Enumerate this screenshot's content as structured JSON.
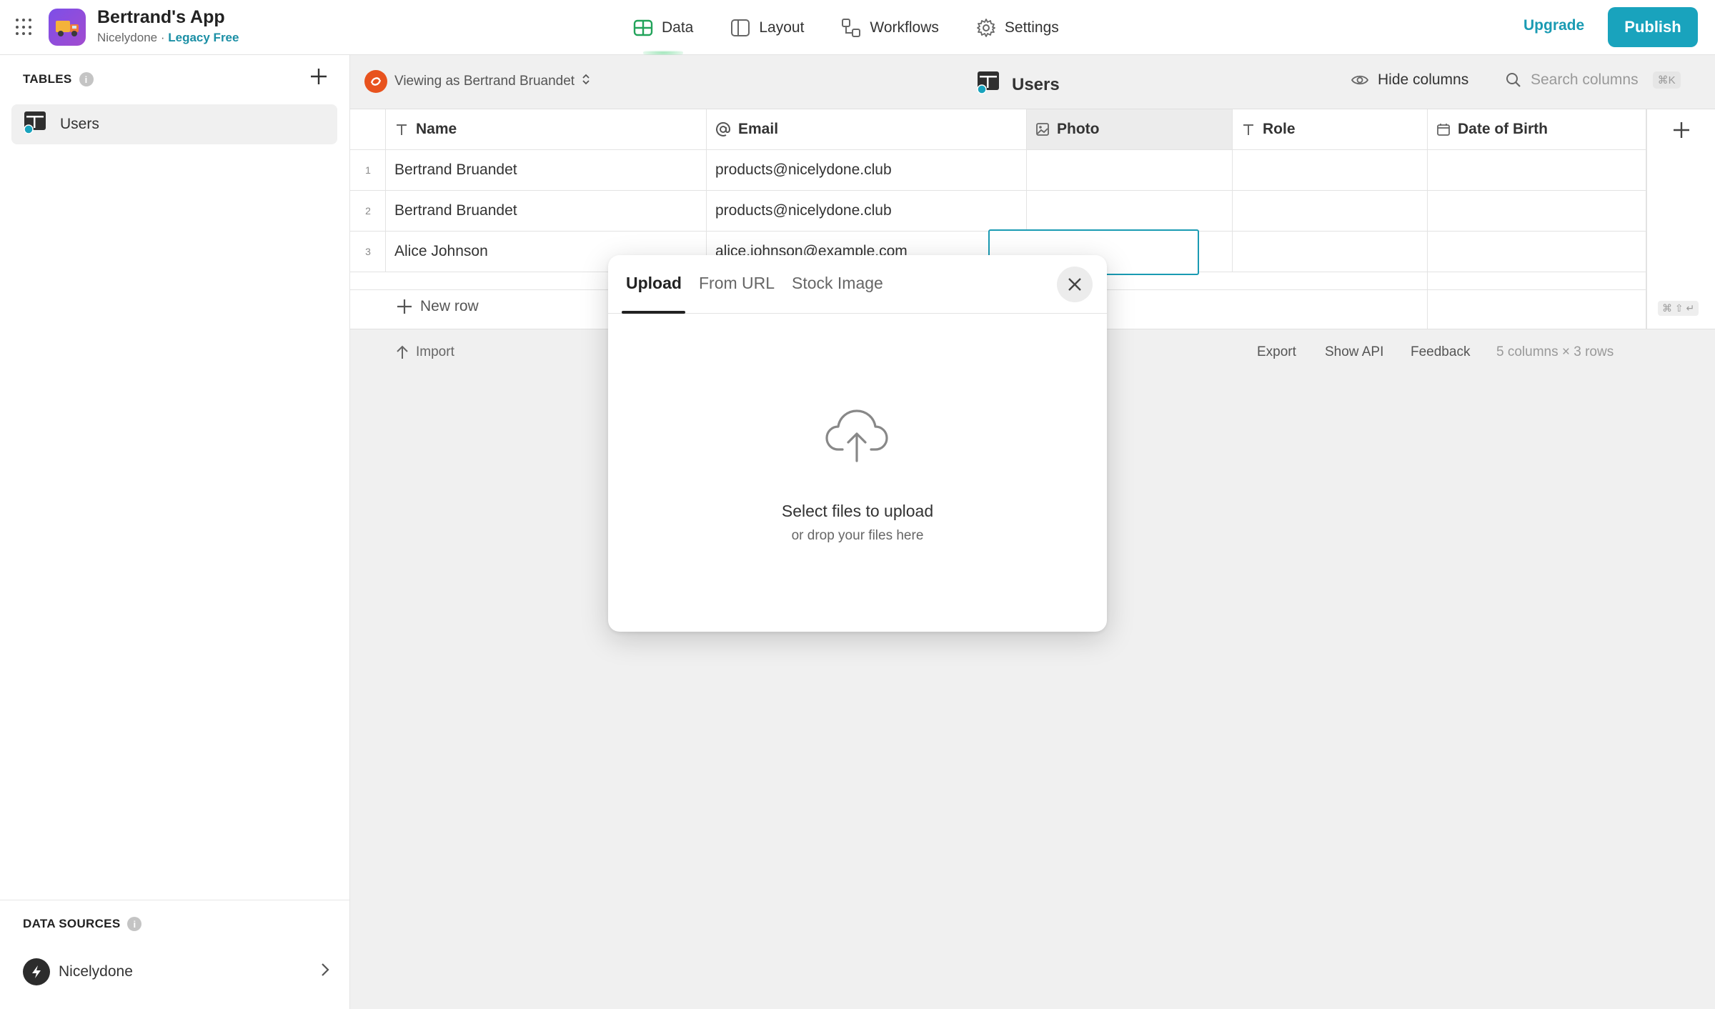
{
  "app": {
    "title": "Bertrand's App",
    "org": "Nicelydone",
    "separator": "·",
    "plan": "Legacy Free"
  },
  "nav": {
    "data": "Data",
    "layout": "Layout",
    "workflows": "Workflows",
    "settings": "Settings"
  },
  "actions": {
    "upgrade": "Upgrade",
    "publish": "Publish"
  },
  "sidebar": {
    "tables_heading": "TABLES",
    "tables": [
      {
        "label": "Users"
      }
    ],
    "data_sources_heading": "DATA SOURCES",
    "data_sources": [
      {
        "label": "Nicelydone"
      }
    ]
  },
  "toolbar": {
    "viewing_as": "Viewing as Bertrand Bruandet",
    "table_title": "Users",
    "hide_columns": "Hide columns",
    "search_placeholder": "Search columns",
    "search_shortcut": "⌘K"
  },
  "table": {
    "columns": [
      {
        "label": "Name",
        "icon": "text-icon"
      },
      {
        "label": "Email",
        "icon": "at-icon"
      },
      {
        "label": "Photo",
        "icon": "image-icon"
      },
      {
        "label": "Role",
        "icon": "text-icon"
      },
      {
        "label": "Date of Birth",
        "icon": "calendar-icon"
      }
    ],
    "rows": [
      {
        "num": "1",
        "name": "Bertrand Bruandet",
        "email": "products@nicelydone.club",
        "photo": "",
        "role": "",
        "dob": ""
      },
      {
        "num": "2",
        "name": "Bertrand Bruandet",
        "email": "products@nicelydone.club",
        "photo": "",
        "role": "",
        "dob": ""
      },
      {
        "num": "3",
        "name": "Alice Johnson",
        "email": "alice.johnson@example.com",
        "photo": "",
        "role": "",
        "dob": ""
      }
    ],
    "new_row": "New row",
    "enter_shortcut": "⌘ ⇧ ↵"
  },
  "footer": {
    "import": "Import",
    "export": "Export",
    "show_api": "Show API",
    "feedback": "Feedback",
    "summary": "5 columns × 3 rows"
  },
  "upload_modal": {
    "tabs": [
      "Upload",
      "From URL",
      "Stock Image"
    ],
    "active_tab": "Upload",
    "title": "Select files to upload",
    "subtitle": "or drop your files here"
  },
  "colors": {
    "accent": "#19a3bd",
    "nav_active_glow": "#22c55e",
    "app_logo": "#7d4ee8",
    "viewer_logo": "#e8531e"
  }
}
